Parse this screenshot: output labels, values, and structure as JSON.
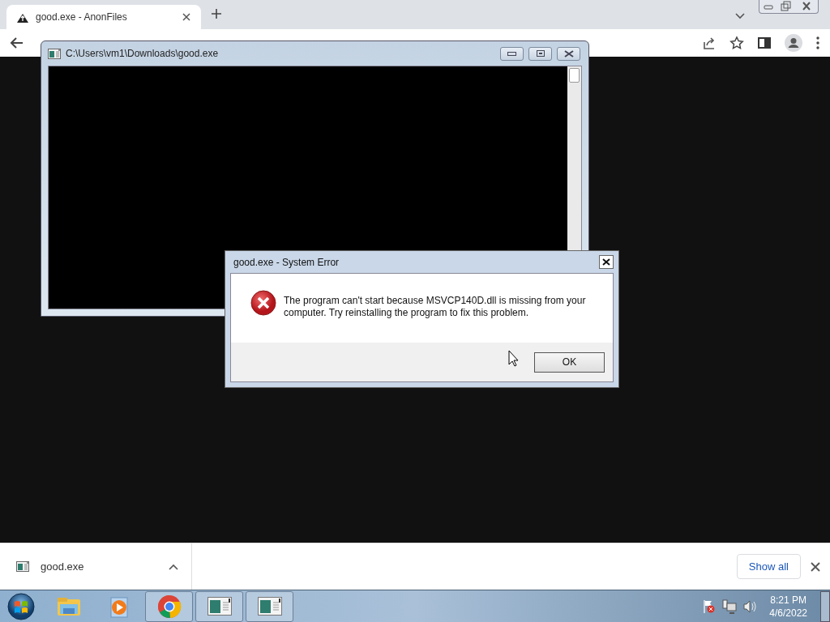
{
  "browser": {
    "tabs": [
      {
        "title": "good.exe - AnonFiles",
        "selected": true
      }
    ]
  },
  "console_window": {
    "title": "C:\\Users\\vm1\\Downloads\\good.exe"
  },
  "error_dialog": {
    "title": "good.exe - System Error",
    "message": "The program can't start because MSVCP140D.dll is missing from your computer. Try reinstalling the program to fix this problem.",
    "buttons": [
      "OK"
    ]
  },
  "download_bar": {
    "items": [
      {
        "name": "good.exe"
      }
    ],
    "show_all": "Show all"
  },
  "taskbar": {
    "apps": [
      {
        "kind": "explorer",
        "running": false
      },
      {
        "kind": "media",
        "running": false
      },
      {
        "kind": "chrome",
        "running": true
      },
      {
        "kind": "console",
        "running": true
      },
      {
        "kind": "console",
        "running": true
      }
    ],
    "clock": {
      "time": "8:21 PM",
      "date": "4/6/2022"
    }
  }
}
